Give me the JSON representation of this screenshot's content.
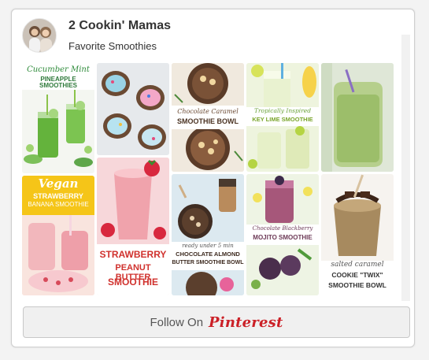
{
  "board": {
    "owner": "2 Cookin' Mamas",
    "name": "Favorite Smoothies"
  },
  "pins": {
    "cucumber_mint": {
      "line1": "Cucumber Mint",
      "line2": "PINEAPPLE SMOOTHIES"
    },
    "vegan_strawberry": {
      "line1": "Vegan",
      "line2": "STRAWBERRY",
      "line3": "BANANA SMOOTHIE"
    },
    "strawberry_pb": {
      "line1": "STRAWBERRY",
      "line2": "PEANUT BUTTER",
      "line3": "SMOOTHIE"
    },
    "chocolate_caramel": {
      "line1": "Chocolate Caramel",
      "line2": "SMOOTHIE BOWL"
    },
    "choc_almond": {
      "line1": "ready under 5 min",
      "line2": "CHOCOLATE ALMOND",
      "line3": "BUTTER SMOOTHIE BOWL"
    },
    "key_lime": {
      "line1": "Tropically Inspired",
      "line2": "KEY LIME SMOOTHIE"
    },
    "mojito": {
      "line1": "Chocolate Blackberry",
      "line2": "MOJITO SMOOTHIE"
    },
    "twix": {
      "line1": "salted caramel",
      "line2": "COOKIE \"TWIX\"",
      "line3": "SMOOTHIE BOWL"
    }
  },
  "follow": {
    "label": "Follow On",
    "brand": "Pinterest"
  },
  "colors": {
    "pinterest_red": "#cb2027",
    "smoothie_green": "#6fbf3e",
    "smoothie_pink": "#e88b9c",
    "banner_yellow": "#f5c518",
    "text_red": "#d0312d"
  }
}
